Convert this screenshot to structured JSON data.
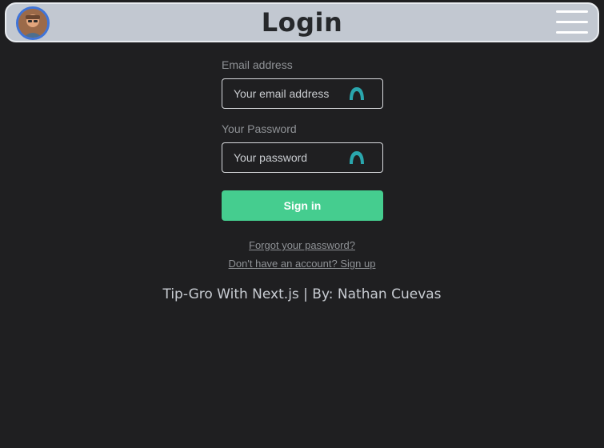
{
  "header": {
    "title": "Login"
  },
  "form": {
    "email_label": "Email address",
    "email_placeholder": "Your email address",
    "password_label": "Your Password",
    "password_placeholder": "Your password",
    "submit_label": "Sign in"
  },
  "links": {
    "forgot_password": "Forgot your password?",
    "sign_up": "Don't have an account? Sign up"
  },
  "footer": {
    "text": "Tip-Gro With Next.js | By: Nathan Cuevas"
  },
  "colors": {
    "header_bg": "#c2c8d1",
    "page_bg": "#1f1f21",
    "accent_button": "#45cd8f",
    "key_icon": "#2aa6ad",
    "avatar_ring": "#3f74d8"
  }
}
